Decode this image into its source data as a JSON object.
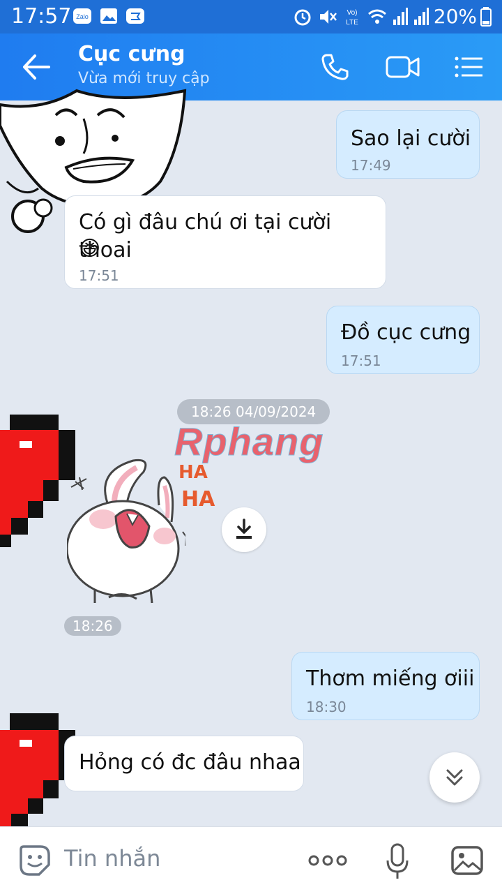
{
  "status_bar": {
    "time": "17:57",
    "battery": "20%",
    "left_icons": [
      "zalo-icon",
      "image-icon",
      "chat-icon"
    ],
    "right_icons": [
      "alarm-icon",
      "mute-icon",
      "volte-icon",
      "wifi-icon",
      "signal-icon",
      "signal-icon",
      "battery-icon"
    ],
    "volte_label": "Vo)\nLTE"
  },
  "header": {
    "title": "Cục cưng",
    "subtitle": "Vừa mới truy cập",
    "icons": [
      "back-arrow-icon",
      "phone-icon",
      "video-call-icon",
      "menu-list-icon"
    ]
  },
  "messages": [
    {
      "side": "me",
      "text": "Sao lại cười",
      "time": "17:49"
    },
    {
      "side": "them",
      "text": "Có gì đâu chú ơi tại cười thoai",
      "emoji": "😆",
      "time": "17:51"
    },
    {
      "side": "me",
      "text": "Đồ cục cưng",
      "time": "17:51"
    },
    {
      "side": "them",
      "text": "Hỏng có đc đâu nhaa"
    }
  ],
  "date_separator": "18:26 04/09/2024",
  "sticker": {
    "brand_text": "Rphang",
    "laugh_text_1": "HA",
    "laugh_text_2": "HA",
    "time": "18:26"
  },
  "last_me_message": {
    "text": "Thơm miếng ơiii",
    "time": "18:30"
  },
  "input_bar": {
    "placeholder": "Tin nhắn",
    "icons": [
      "sticker-emoji-icon",
      "more-options-icon",
      "microphone-icon",
      "gallery-icon"
    ]
  },
  "colors": {
    "header_start": "#1f7cf0",
    "header_end": "#2a9bf6",
    "my_bubble": "#d5ecff",
    "their_bubble": "#ffffff",
    "chat_bg": "#e2e8f1"
  }
}
